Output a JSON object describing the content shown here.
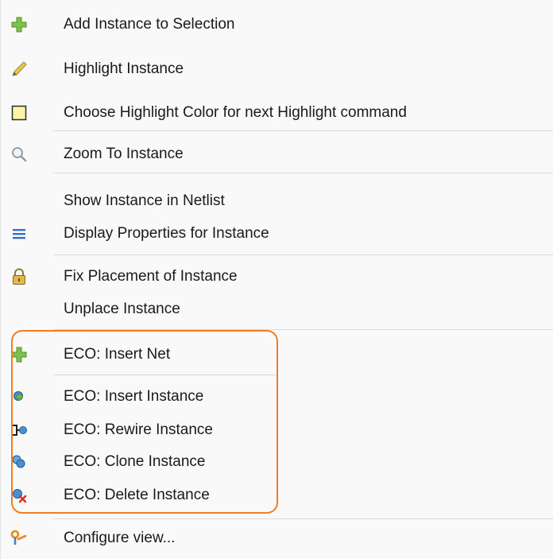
{
  "menu": {
    "items": [
      {
        "label": "Add Instance to Selection",
        "icon": "plus-icon"
      },
      {
        "label": "Highlight Instance",
        "icon": "highlighter-icon"
      },
      {
        "label": "Choose Highlight Color for next Highlight command",
        "icon": "color-swatch-icon"
      },
      {
        "label": "Zoom To Instance",
        "icon": "magnifier-icon"
      },
      {
        "label": "Show Instance in Netlist",
        "icon": ""
      },
      {
        "label": "Display Properties for Instance",
        "icon": "properties-icon"
      },
      {
        "label": "Fix Placement of Instance",
        "icon": "lock-icon"
      },
      {
        "label": "Unplace Instance",
        "icon": ""
      },
      {
        "label": "ECO: Insert Net",
        "icon": "plus-icon"
      },
      {
        "label": "ECO: Insert Instance",
        "icon": "eco-insert-instance-icon"
      },
      {
        "label": "ECO: Rewire Instance",
        "icon": "eco-rewire-icon"
      },
      {
        "label": "ECO: Clone Instance",
        "icon": "eco-clone-icon"
      },
      {
        "label": "ECO: Delete Instance",
        "icon": "eco-delete-icon"
      },
      {
        "label": "Configure view...",
        "icon": "configure-icon"
      }
    ]
  },
  "colors": {
    "highlight_swatch": "#fdf2a6",
    "eco_group_outline": "#f07d22",
    "plus_green": "#6ab23f",
    "eco_blue": "#3b86c5",
    "delete_red": "#e0302e",
    "menu_blue": "#2f6fd1"
  }
}
